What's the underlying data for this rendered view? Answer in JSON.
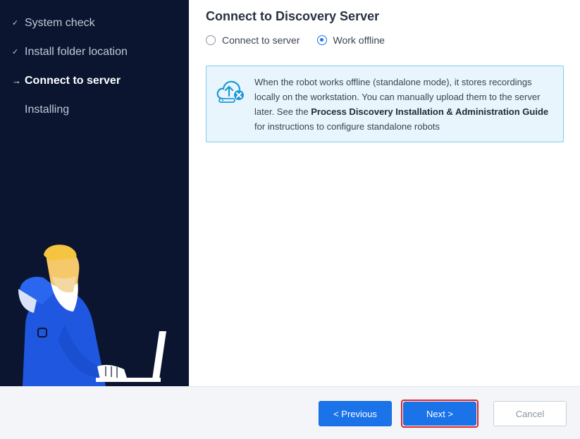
{
  "sidebar": {
    "steps": [
      {
        "label": "System check",
        "marker": "✓",
        "state": "done"
      },
      {
        "label": "Install folder location",
        "marker": "✓",
        "state": "done"
      },
      {
        "label": "Connect to server",
        "marker": "→",
        "state": "active"
      },
      {
        "label": "Installing",
        "marker": "",
        "state": "pending"
      }
    ],
    "illustration_icon": "person-with-laptop-illustration"
  },
  "main": {
    "title": "Connect to Discovery Server",
    "options": [
      {
        "label": "Connect to server",
        "selected": false
      },
      {
        "label": "Work offline",
        "selected": true
      }
    ],
    "info": {
      "icon": "cloud-upload-offline-icon",
      "text_1": "When the robot works offline (standalone mode), it stores recordings locally on the workstation. You can manually upload them to the server later. See the ",
      "text_bold": "Process Discovery Installation & Administration Guide",
      "text_2": " for instructions to configure standalone robots"
    }
  },
  "footer": {
    "previous_label": "< Previous",
    "next_label": "Next >",
    "cancel_label": "Cancel"
  },
  "colors": {
    "sidebar_bg": "#0b1530",
    "accent": "#1a73e8",
    "info_bg": "#e8f5fc",
    "info_border": "#7ecdee",
    "highlight": "#e0242b"
  }
}
